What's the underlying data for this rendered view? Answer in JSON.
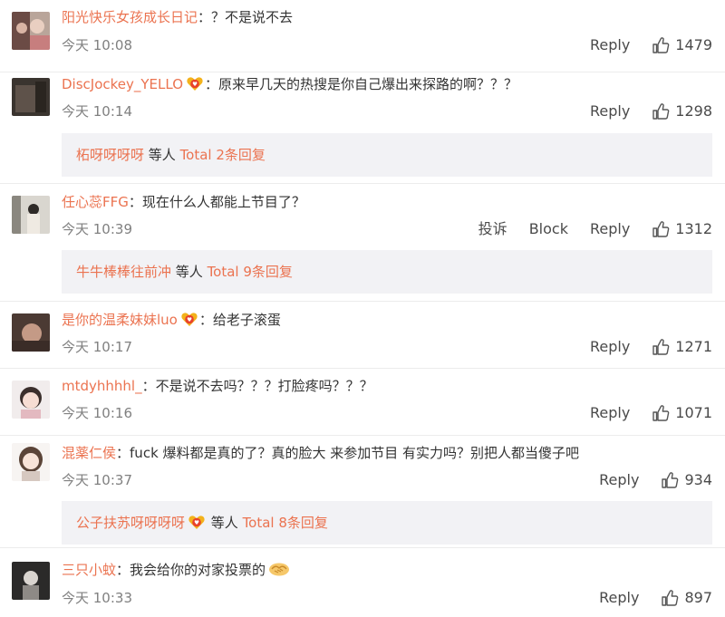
{
  "comments": [
    {
      "user": "阳光快乐女孩成长日记",
      "badge": false,
      "colon": "：",
      "text": "？不是说不去",
      "time": "今天 10:08",
      "actions": [
        "Reply"
      ],
      "likes": "1479"
    },
    {
      "user": "DiscJockey_YELLO",
      "badge": true,
      "colon": "：",
      "text": "原来早几天的热搜是你自己爆出来探路的啊？？？",
      "time": "今天 10:14",
      "actions": [
        "Reply"
      ],
      "likes": "1298",
      "replies": {
        "user": "柘呀呀呀呀",
        "badge": false,
        "mid": " 等人 ",
        "link": "Total 2条回复"
      }
    },
    {
      "user": "任心蕊FFG",
      "badge": false,
      "colon": "：",
      "text": "现在什么人都能上节目了？",
      "time": "今天 10:39",
      "actions": [
        "投诉",
        "Block",
        "Reply"
      ],
      "likes": "1312",
      "replies": {
        "user": "牛牛棒棒往前冲",
        "badge": false,
        "mid": " 等人 ",
        "link": "Total 9条回复"
      }
    },
    {
      "user": "是你的温柔妹妹luo",
      "badge": true,
      "colon": "：",
      "text": "给老子滚蛋",
      "time": "今天 10:17",
      "actions": [
        "Reply"
      ],
      "likes": "1271"
    },
    {
      "user": "mtdyhhhhl_",
      "badge": false,
      "colon": "：",
      "text": "不是说不去吗？？？打脸疼吗？？？",
      "time": "今天 10:16",
      "actions": [
        "Reply"
      ],
      "likes": "1071"
    },
    {
      "user": "混薬仁侯",
      "badge": false,
      "colon": "：",
      "text": "fuck 爆料都是真的了？真的脸大 来参加节目 有实力吗？别把人都当傻子吧",
      "time": "今天 10:37",
      "actions": [
        "Reply"
      ],
      "likes": "934",
      "replies": {
        "user": "公子扶苏呀呀呀呀",
        "badge": true,
        "mid": " 等人 ",
        "link": "Total 8条回复"
      }
    },
    {
      "user": "三只小蚊",
      "badge": false,
      "colon": "：",
      "text": "我会给你的对家投票的",
      "emoji": "handshake",
      "time": "今天 10:33",
      "actions": [
        "Reply"
      ],
      "likes": "897"
    }
  ],
  "colors": {
    "username": "#eb7350",
    "reply_bg": "#f2f2f5",
    "time": "#808080"
  },
  "icons": {
    "like": "thumbs-up-icon",
    "badge": "vip-heart-badge-icon",
    "emoji": "handshake-emoji-icon"
  }
}
